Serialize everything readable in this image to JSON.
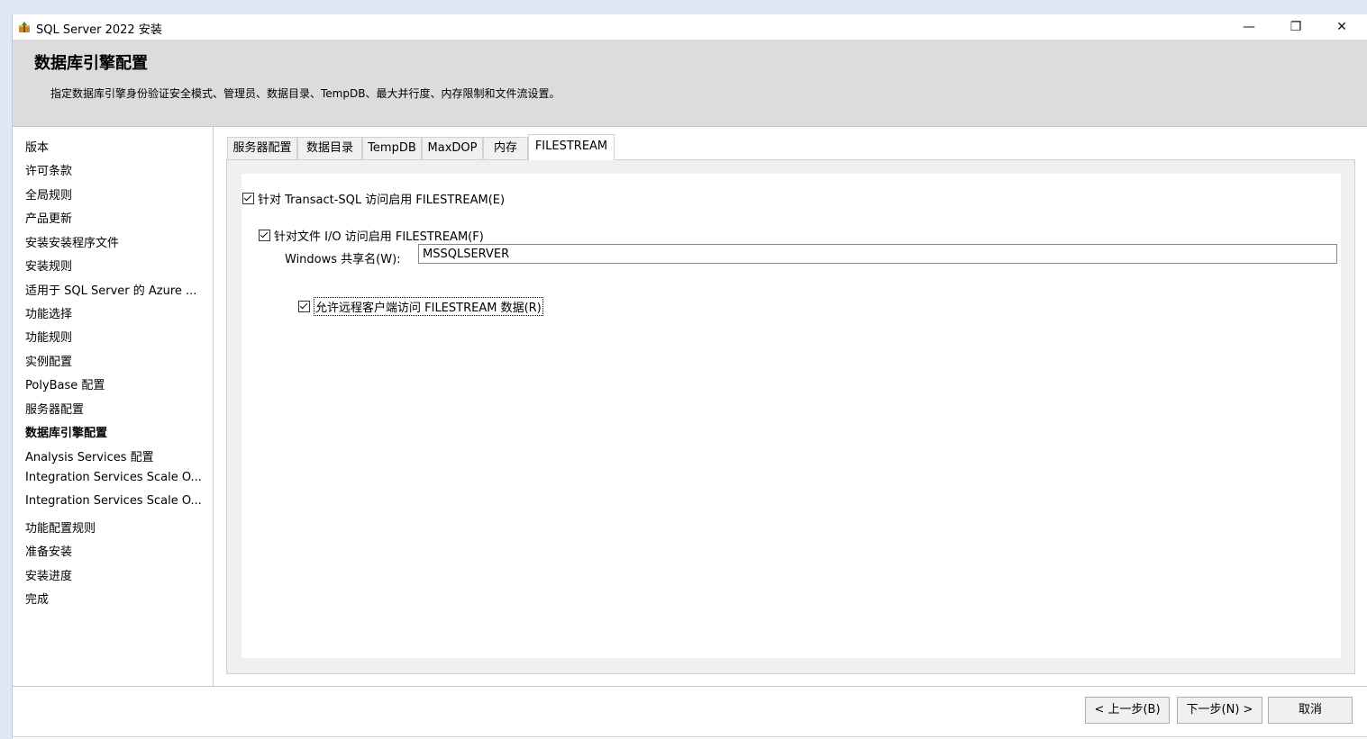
{
  "window": {
    "title": "SQL Server 2022 安装",
    "minimize_label": "—",
    "restore_label": "❐",
    "close_label": "✕"
  },
  "header": {
    "title": "数据库引擎配置",
    "subtitle": "指定数据库引擎身份验证安全模式、管理员、数据目录、TempDB、最大并行度、内存限制和文件流设置。"
  },
  "nav": {
    "items": [
      {
        "label": "版本"
      },
      {
        "label": "许可条款"
      },
      {
        "label": "全局规则"
      },
      {
        "label": "产品更新"
      },
      {
        "label": "安装安装程序文件"
      },
      {
        "label": "安装规则"
      },
      {
        "label": "适用于 SQL Server 的 Azure ..."
      },
      {
        "label": "功能选择"
      },
      {
        "label": "功能规则"
      },
      {
        "label": "实例配置"
      },
      {
        "label": "PolyBase 配置"
      },
      {
        "label": "服务器配置"
      },
      {
        "label": "数据库引擎配置"
      },
      {
        "label": "Analysis Services 配置"
      },
      {
        "label": "Integration Services Scale O..."
      },
      {
        "label": "Integration Services Scale O..."
      },
      {
        "label": "功能配置规则"
      },
      {
        "label": "准备安装"
      },
      {
        "label": "安装进度"
      },
      {
        "label": "完成"
      }
    ],
    "active_index": 12
  },
  "tabs": [
    {
      "label": "服务器配置"
    },
    {
      "label": "数据目录"
    },
    {
      "label": "TempDB"
    },
    {
      "label": "MaxDOP"
    },
    {
      "label": "内存"
    },
    {
      "label": "FILESTREAM"
    }
  ],
  "filestream": {
    "tsql_label": "针对 Transact-SQL 访问启用 FILESTREAM(E)",
    "tsql_checked": true,
    "fileio_label": "针对文件 I/O 访问启用 FILESTREAM(F)",
    "fileio_checked": true,
    "share_label": "Windows 共享名(W):",
    "share_value": "MSSQLSERVER",
    "remote_label": "允许远程客户端访问 FILESTREAM 数据(R)",
    "remote_checked": true
  },
  "buttons": {
    "back": "< 上一步(B)",
    "next": "下一步(N) >",
    "cancel": "取消"
  }
}
